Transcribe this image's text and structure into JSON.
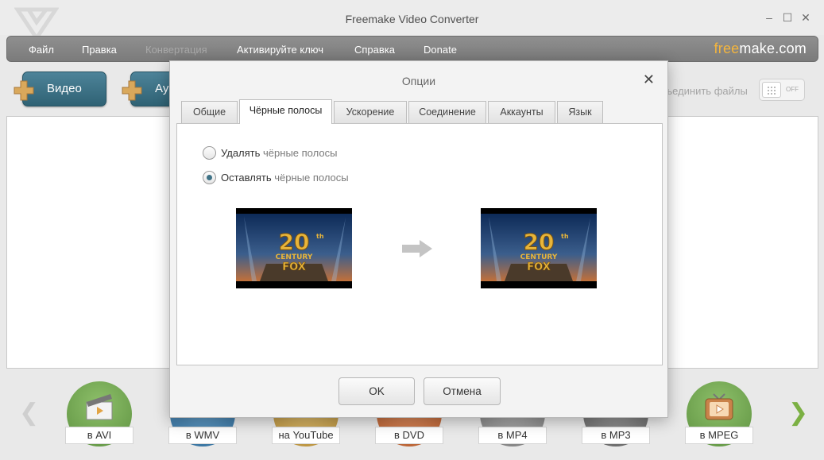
{
  "window": {
    "title": "Freemake Video Converter",
    "controls": {
      "minimize": "–",
      "maximize": "☐",
      "close": "✕"
    }
  },
  "menu": {
    "items": [
      {
        "label": "Файл",
        "enabled": true
      },
      {
        "label": "Правка",
        "enabled": true
      },
      {
        "label": "Конвертация",
        "enabled": false
      },
      {
        "label": "Активируйте ключ",
        "enabled": true
      },
      {
        "label": "Справка",
        "enabled": true
      },
      {
        "label": "Donate",
        "enabled": true
      }
    ],
    "brand": {
      "part1": "free",
      "part2": "make.com"
    }
  },
  "toolbar": {
    "video_label": "Видео",
    "audio_label": "Ау",
    "merge_label": "ъединить файлы",
    "merge_toggle": "OFF"
  },
  "formats": [
    {
      "label": "в AVI",
      "icon": "clapperboard-icon",
      "color": "#6ea24f"
    },
    {
      "label": "в WMV",
      "icon": "wmv-icon",
      "color": "#3d78a6"
    },
    {
      "label": "на YouTube",
      "icon": "youtube-icon",
      "color": "#c8a24b"
    },
    {
      "label": "в DVD",
      "icon": "dvd-icon",
      "color": "#c96f3a"
    },
    {
      "label": "в MP4",
      "icon": "mp4-icon",
      "color": "#8a8a8a"
    },
    {
      "label": "в MP3",
      "icon": "mp3-icon",
      "color": "#6f6f6f"
    },
    {
      "label": "в MPEG",
      "icon": "tv-icon",
      "color": "#6ea24f"
    }
  ],
  "dialog": {
    "title": "Опции",
    "close": "✕",
    "tabs": [
      {
        "label": "Общие",
        "active": false
      },
      {
        "label": "Чёрные полосы",
        "active": true
      },
      {
        "label": "Ускорение",
        "active": false
      },
      {
        "label": "Соединение",
        "active": false
      },
      {
        "label": "Аккаунты",
        "active": false
      },
      {
        "label": "Язык",
        "active": false
      }
    ],
    "options": [
      {
        "verb": "Удалять",
        "rest": " чёрные полосы",
        "checked": false
      },
      {
        "verb": "Оставлять",
        "rest": " чёрные полосы",
        "checked": true
      }
    ],
    "preview": {
      "thumb_text_top": "20",
      "thumb_text_th": "th",
      "thumb_text_century": "CENTURY",
      "thumb_text_fox": "FOX"
    },
    "ok_label": "OK",
    "cancel_label": "Отмена"
  },
  "colors": {
    "menubar": "#868686",
    "accent_teal": "#3f7286",
    "brand_accent": "#f4b53d"
  }
}
